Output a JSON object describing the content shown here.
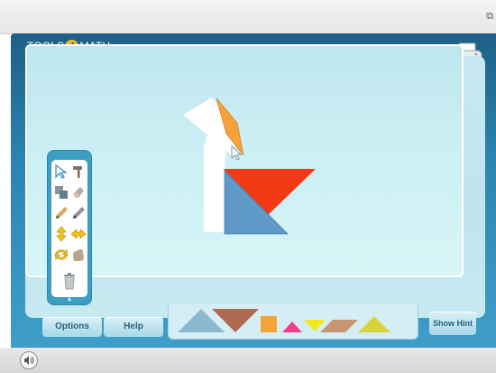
{
  "window": {
    "restore_icon": "restore-window-icon"
  },
  "app": {
    "logo": {
      "prefix": "TOOLS",
      "badge": "4",
      "suffix": "MATH"
    },
    "print_icon": "printer-icon"
  },
  "toolbox": {
    "tools": [
      {
        "name": "select-arrow-icon"
      },
      {
        "name": "hammer-icon"
      },
      {
        "name": "group-shapes-icon"
      },
      {
        "name": "eraser-icon"
      },
      {
        "name": "pencil-icon"
      },
      {
        "name": "pen-icon"
      },
      {
        "name": "flip-vertical-icon"
      },
      {
        "name": "flip-horizontal-icon"
      },
      {
        "name": "rotate-icon"
      },
      {
        "name": "glove-icon"
      },
      {
        "name": "trash-icon"
      }
    ],
    "collapse_glyph": "▲"
  },
  "buttons": {
    "options": "Options",
    "help": "Help",
    "show_hint": "Show Hint"
  },
  "tray_pieces": [
    {
      "name": "tray-large-triangle-blue",
      "color": "#8cb8cf"
    },
    {
      "name": "tray-large-triangle-brown",
      "color": "#b06a52"
    },
    {
      "name": "tray-square-orange",
      "color": "#f3a43b"
    },
    {
      "name": "tray-small-triangle-pink",
      "color": "#f03c8a"
    },
    {
      "name": "tray-small-triangle-yellow",
      "color": "#f5e81a"
    },
    {
      "name": "tray-parallelogram-brown",
      "color": "#c9956f"
    },
    {
      "name": "tray-medium-triangle-yellow",
      "color": "#d8d33a"
    }
  ],
  "colors": {
    "orange_piece": "#f5a23c",
    "red_piece": "#f23b16",
    "blue_piece": "#5f99c7",
    "silhouette": "#ffffff"
  }
}
